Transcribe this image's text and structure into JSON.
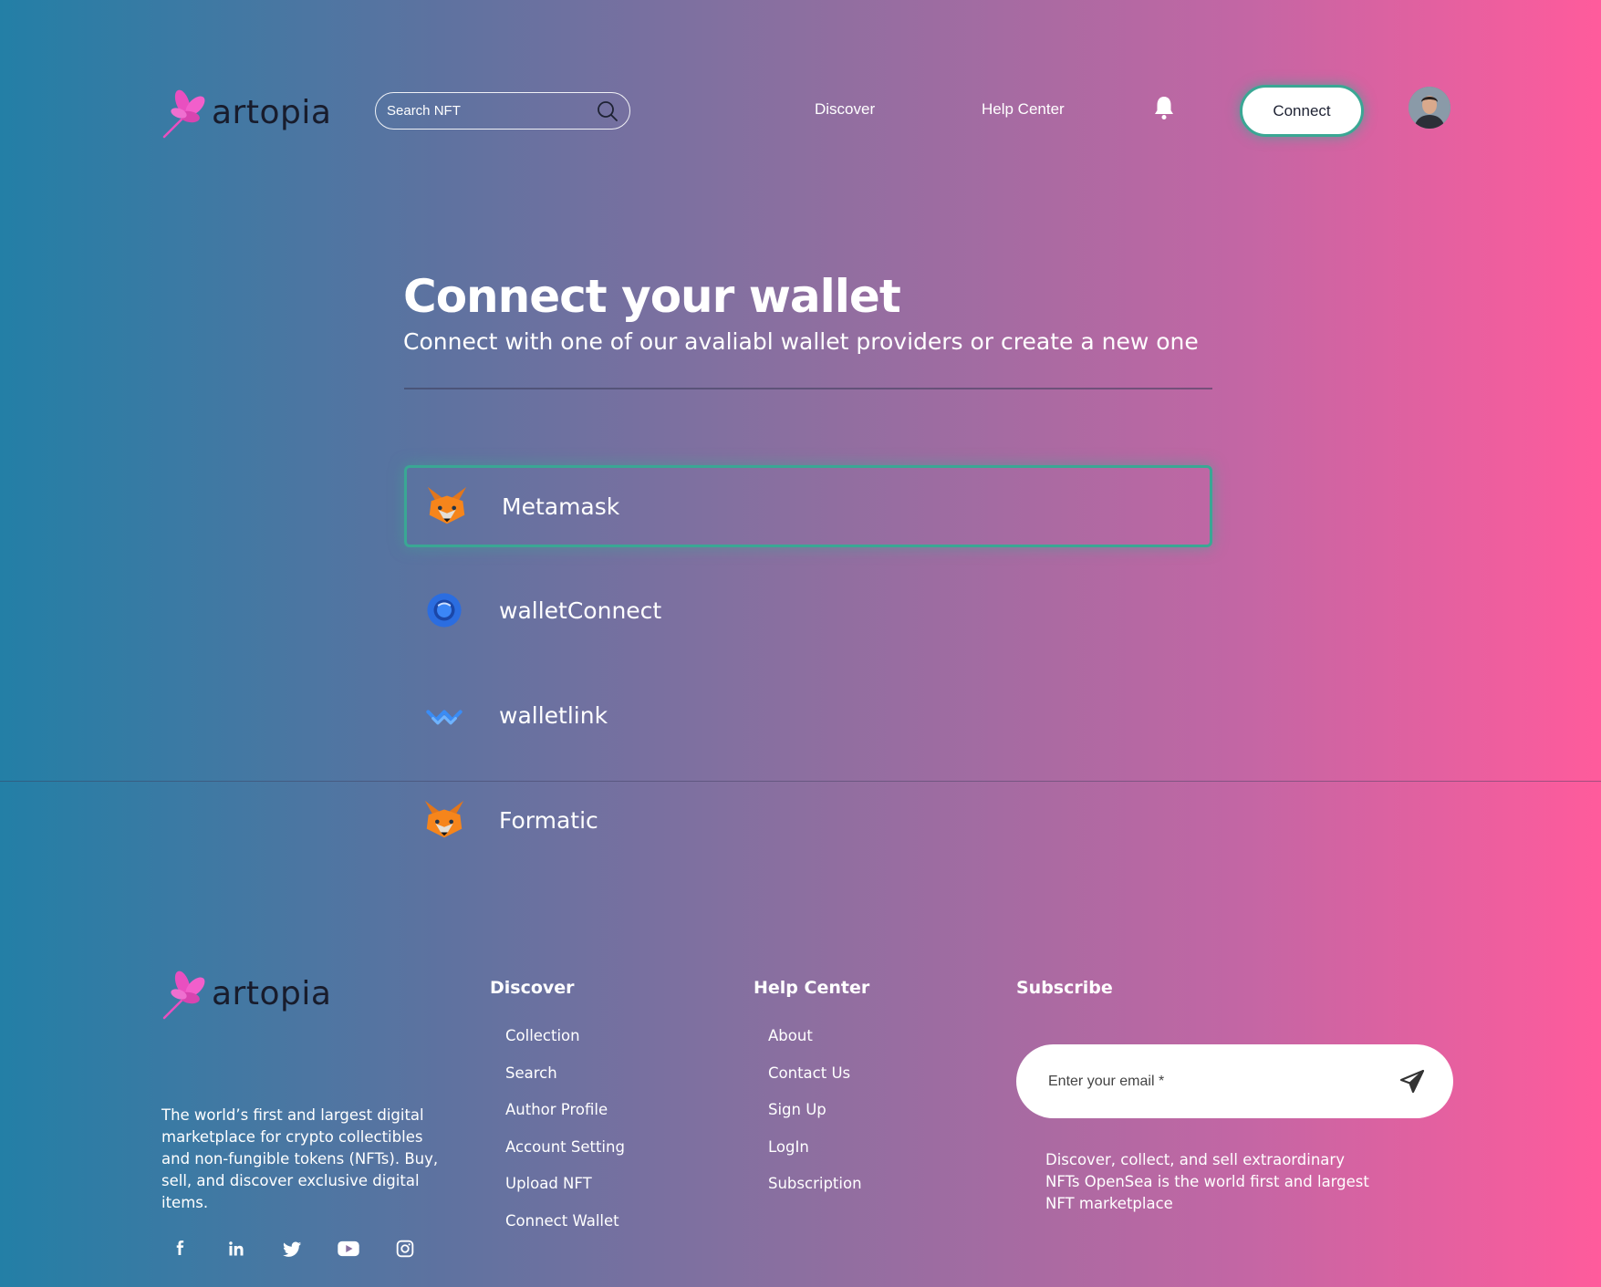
{
  "brand": {
    "name": "artopia"
  },
  "header": {
    "search_placeholder": "Search NFT",
    "nav": [
      "Discover",
      "Help Center"
    ],
    "connect_label": "Connect"
  },
  "main": {
    "title": "Connect your wallet",
    "subtitle": "Connect with one of our avaliabl wallet providers or create a new one",
    "wallets": [
      {
        "label": "Metamask",
        "icon": "metamask-fox-icon",
        "selected": true
      },
      {
        "label": "walletConnect",
        "icon": "walletconnect-icon",
        "selected": false
      },
      {
        "label": "walletlink",
        "icon": "walletlink-icon",
        "selected": false
      },
      {
        "label": "Formatic",
        "icon": "metamask-fox-icon",
        "selected": false
      }
    ]
  },
  "footer": {
    "about": "The world’s first and largest digital marketplace for crypto collectibles and non-fungible tokens (NFTs). Buy, sell, and discover exclusive digital items.",
    "social": [
      "facebook-icon",
      "linkedin-icon",
      "twitter-icon",
      "youtube-icon",
      "instagram-icon"
    ],
    "discover": {
      "title": "Discover",
      "links": [
        "Collection",
        "Search",
        "Author Profile",
        "Account Setting",
        "Upload NFT",
        "Connect Wallet"
      ]
    },
    "help": {
      "title": "Help Center",
      "links": [
        "About",
        "Contact Us",
        "Sign Up",
        "LogIn",
        "Subscription"
      ]
    },
    "subscribe": {
      "title": "Subscribe",
      "placeholder": "Enter your email *",
      "text": "Discover, collect, and sell extraordinary NFTs OpenSea is the world first and largest NFT marketplace"
    }
  },
  "colors": {
    "accent": "#3aa794",
    "logo_pink": "#e94fc0",
    "gradient_left": "#237fa6",
    "gradient_right": "#ff5b9c"
  }
}
